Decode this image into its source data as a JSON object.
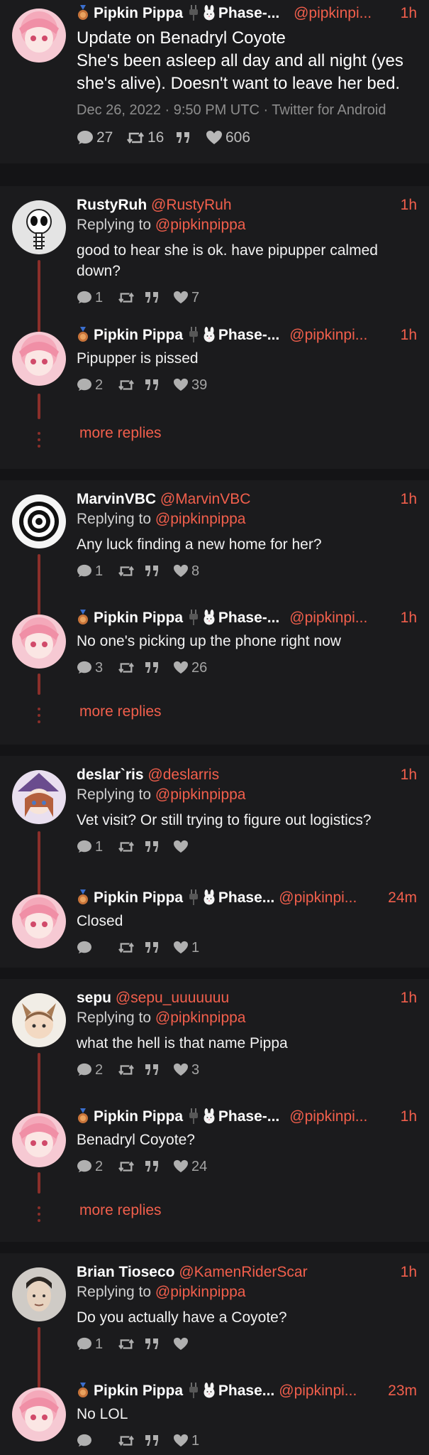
{
  "author": {
    "name": "Pipkin Pippa",
    "phase": "Phase-...",
    "phase_alt": "Phase...",
    "handle": "@pipkinpi..."
  },
  "main_tweet": {
    "time": "1h",
    "title": "Update on Benadryl Coyote",
    "body": "She's been asleep all day and all night (yes she's alive). Doesn't want to leave her bed.",
    "timestamp": "Dec 26, 2022 · 9:50 PM UTC · Twitter for Android",
    "replies": "27",
    "retweets": "16",
    "likes": "606"
  },
  "replying_label": "Replying to",
  "replying_handle": "@pipkinpippa",
  "more_replies_label": "more replies",
  "threads": [
    {
      "reply": {
        "name": "RustyRuh",
        "handle": "@RustyRuh",
        "time": "1h",
        "text": "good to hear she is ok. have pipupper calmed down?",
        "replies": "1",
        "likes": "7"
      },
      "pippa": {
        "time": "1h",
        "text": "Pipupper is pissed",
        "replies": "2",
        "likes": "39"
      }
    },
    {
      "reply": {
        "name": "MarvinVBC",
        "handle": "@MarvinVBC",
        "time": "1h",
        "text": "Any luck finding a new home for her?",
        "replies": "1",
        "likes": "8"
      },
      "pippa": {
        "time": "1h",
        "text": "No one's picking up the phone right now",
        "replies": "3",
        "likes": "26"
      }
    },
    {
      "reply": {
        "name": "deslar`ris",
        "handle": "@deslarris",
        "time": "1h",
        "text": "Vet visit? Or still trying to figure out logistics?",
        "replies": "1",
        "likes": ""
      },
      "pippa": {
        "time": "24m",
        "text": "Closed",
        "replies": "",
        "likes": "1"
      }
    },
    {
      "reply": {
        "name": "sepu",
        "handle": "@sepu_uuuuuuu",
        "time": "1h",
        "text": "what the hell is that name Pippa",
        "replies": "2",
        "likes": "3"
      },
      "pippa": {
        "time": "1h",
        "text": "Benadryl Coyote?",
        "replies": "2",
        "likes": "24"
      }
    },
    {
      "reply": {
        "name": "Brian Tioseco",
        "handle": "@KamenRiderScar",
        "time": "1h",
        "text": "Do you actually have a Coyote?",
        "replies": "1",
        "likes": ""
      },
      "pippa": {
        "time": "23m",
        "text": "No LOL",
        "replies": "",
        "likes": "1"
      }
    }
  ],
  "colors": {
    "accent": "#f25f4c",
    "background": "#141416",
    "card": "#1b1b1d",
    "thread_line": "#8b2f2a"
  },
  "icons": {
    "reply": "speech-bubble-icon",
    "retweet": "retweet-icon",
    "quote": "quote-icon",
    "like": "heart-icon",
    "medal": "medal-icon",
    "plug": "plug-icon",
    "rabbit": "rabbit-icon"
  }
}
